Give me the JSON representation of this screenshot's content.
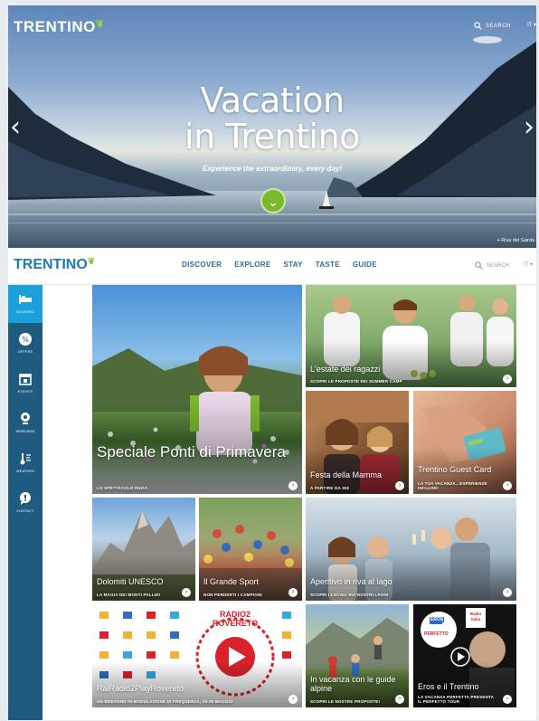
{
  "hero": {
    "logo": "TRENTINO",
    "search_label": "SEARCH",
    "lang": "IT ▾",
    "title_line1": "Vacation",
    "title_line2": "in Trentino",
    "subtitle": "Experience the extraordinary, every day!",
    "caption": "Riva del Garda",
    "prev_icon": "chevron-left-icon",
    "next_icon": "chevron-right-icon",
    "down_icon": "chevron-down-icon"
  },
  "nav": {
    "logo": "TRENTINO",
    "links": [
      "DISCOVER",
      "EXPLORE",
      "STAY",
      "TASTE",
      "GUIDE"
    ],
    "search_label": "SEARCH",
    "lang": "IT ▾"
  },
  "sidebar": {
    "items": [
      {
        "label": "BOOKING",
        "icon": "bed-icon"
      },
      {
        "label": "OFFERS",
        "icon": "percent-icon"
      },
      {
        "label": "EVENTS",
        "icon": "calendar-icon"
      },
      {
        "label": "WEBCAMS",
        "icon": "webcam-icon"
      },
      {
        "label": "WEATHER",
        "icon": "weather-icon"
      },
      {
        "label": "CONTACT",
        "icon": "chat-icon"
      }
    ]
  },
  "tiles": [
    {
      "title": "Speciale Ponti di Primavera",
      "subtitle": "LO SPETTACOLO INIZIA"
    },
    {
      "title": "L'estate dei ragazzi",
      "subtitle": "SCOPRI LE PROPOSTE DEI SUMMER CAMP"
    },
    {
      "title": "Festa della Mamma",
      "subtitle": "A PARTIRE DA 30€"
    },
    {
      "title": "Trentino Guest Card",
      "subtitle": "LA TUA VACANZA...ESPERIENZE INCLUSE!"
    },
    {
      "title": "Dolomiti UNESCO",
      "subtitle": "LA MAGIA DEI MONTI PALLIDI"
    },
    {
      "title": "Il Grande Sport",
      "subtitle": "NON PERDERTI I CAMPIONI"
    },
    {
      "title": "Aperitivo in riva al lago",
      "subtitle": "SCOPRI I LOCALI SUI NOSTRI LAGHI"
    },
    {
      "title": "RaiRadio2PlayRovereto",
      "subtitle": "UN WEEKEND IN MODULAZIONE DI FREQUENZA, 26-28 MAGGIO"
    },
    {
      "title": "In vacanza con le guide alpine",
      "subtitle": "SCOPRI LE NOSTRE PROPOSTE!"
    },
    {
      "title": "Eros e il Trentino",
      "subtitle": "LA VACANZA PERFETTA PRESENTA IL PERFETTO TOUR"
    }
  ],
  "radio2_logo": "RADIO2 ROVERETO",
  "eros_badge_text": "EROS",
  "eros_tour_text": "PERFETTO",
  "radio_italia_text": "Radio Italia",
  "colors": {
    "sidebar": "#1f5a80",
    "sidebar_active": "#1aa0db",
    "nav_link": "#2c6c9c",
    "accent_green": "#7ab82f",
    "radio2_red": "#d9222a"
  }
}
